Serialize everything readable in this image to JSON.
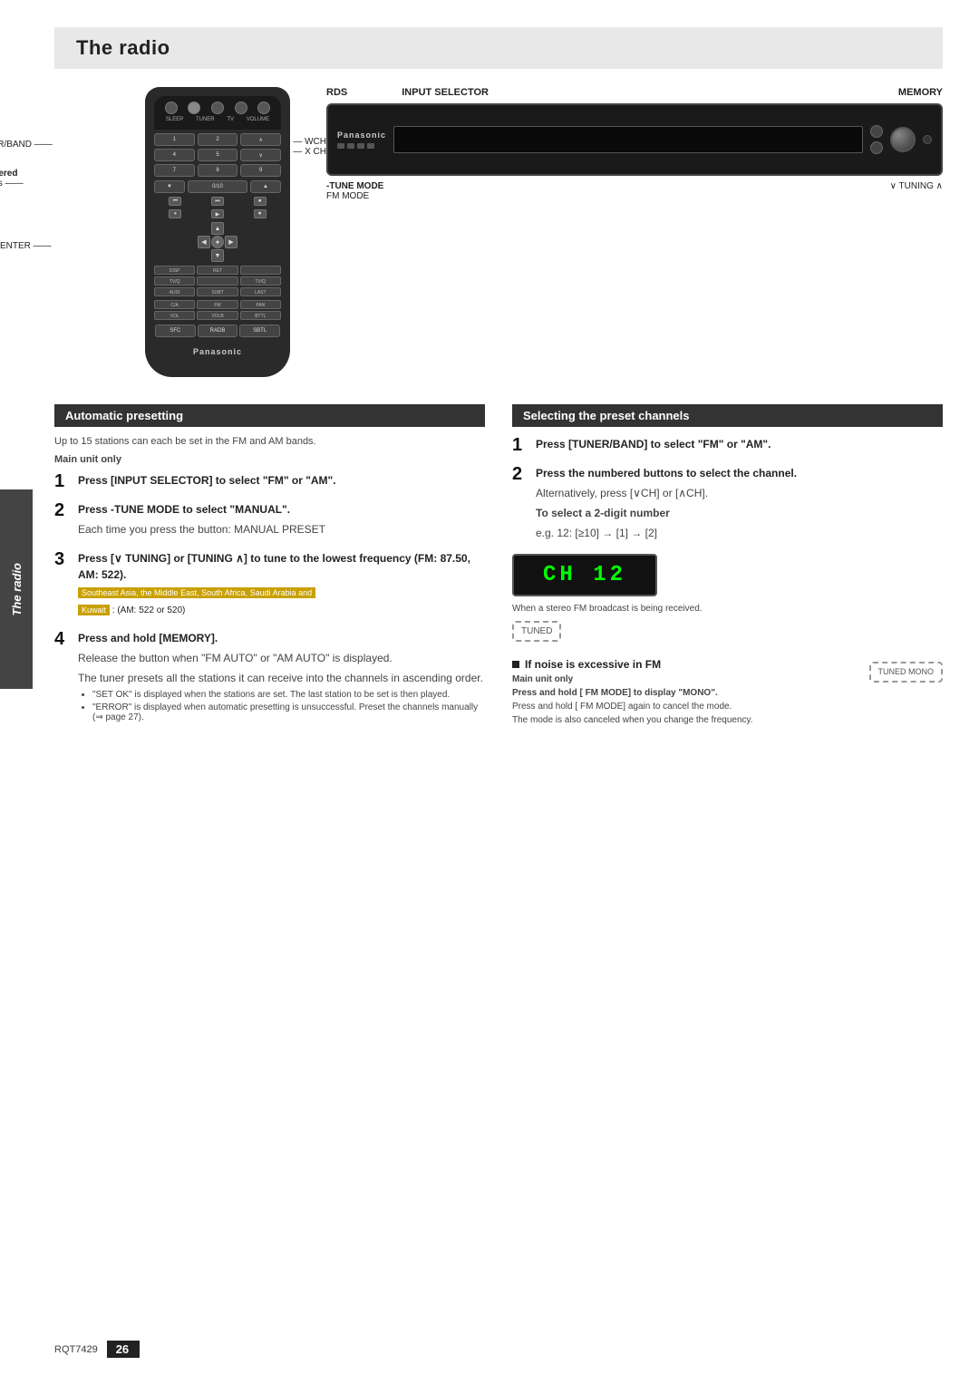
{
  "page": {
    "title": "The radio",
    "page_number": "26",
    "rqt_code": "RQT7429",
    "sidebar_label": "The radio"
  },
  "remote": {
    "brand": "Panasonic",
    "callout_tuner": "TUNER/BAND",
    "callout_numbered_label1": "Numbered",
    "callout_numbered_label2": "buttons",
    "callout_wch": "WCH",
    "callout_xch": "X CH",
    "callout_enter": "ENTER"
  },
  "unit": {
    "brand": "Panasonic",
    "labels_top": {
      "rds": "RDS",
      "input_selector": "INPUT SELECTOR",
      "memory": "MEMORY"
    },
    "labels_bottom": {
      "tune_mode": "-TUNE MODE",
      "fm_mode": "FM MODE",
      "tuning": "∨ TUNING ∧"
    }
  },
  "automatic_presetting": {
    "header": "Automatic presetting",
    "intro": "Up to 15 stations can each be set in the FM and AM bands.",
    "main_unit_only": "Main unit only",
    "steps": [
      {
        "number": "1",
        "text": "Press [INPUT SELECTOR] to select \"FM\" or \"AM\"."
      },
      {
        "number": "2",
        "text": "Press -TUNE MODE to select \"MANUAL\".",
        "sub": "Each time you press the button: MANUAL    PRESET"
      },
      {
        "number": "3",
        "text": "Press [∨ TUNING] or [TUNING ∧] to tune to the lowest frequency (FM: 87.50, AM: 522).",
        "highlight": "Southeast Asia, the Middle East, South Africa, Saudi Arabia and",
        "highlight2": "Kuwait",
        "highlight_suffix": ": (AM: 522 or 520)"
      },
      {
        "number": "4",
        "text": "Press and hold [MEMORY].",
        "note1": "Release the button when \"FM AUTO\" or \"AM AUTO\" is displayed.",
        "note2": "The tuner presets all the stations it can receive into the channels in ascending order.",
        "bullets": [
          "\"SET OK\" is displayed when the stations are set. The last station to be set is then played.",
          "\"ERROR\" is displayed when automatic presetting is unsuccessful. Preset the channels manually (⇒ page 27)."
        ]
      }
    ]
  },
  "selecting_preset": {
    "header": "Selecting the preset channels",
    "steps": [
      {
        "number": "1",
        "text": "Press [TUNER/BAND] to select \"FM\" or \"AM\"."
      },
      {
        "number": "2",
        "text": "Press the numbered buttons to select the channel.",
        "sub1": "Alternatively, press [∨CH] or [∧CH].",
        "sub2": "To select a 2-digit number",
        "sub3": "e.g. 12: [≥10] → [1] → [2]"
      }
    ],
    "display_value": "CH 12",
    "stereo_note": "When a stereo FM broadcast is being received.",
    "tuned_label": "TUNED",
    "noise_section": {
      "header": "If noise is excessive in FM",
      "main_unit_only": "Main unit only",
      "instruction": "Press and hold [  FM MODE] to display \"MONO\".",
      "tuned_mono": "TUNED MONO",
      "note1": "Press and hold [  FM MODE] again to cancel the mode.",
      "note2": "The mode is also canceled when you change the frequency."
    }
  }
}
